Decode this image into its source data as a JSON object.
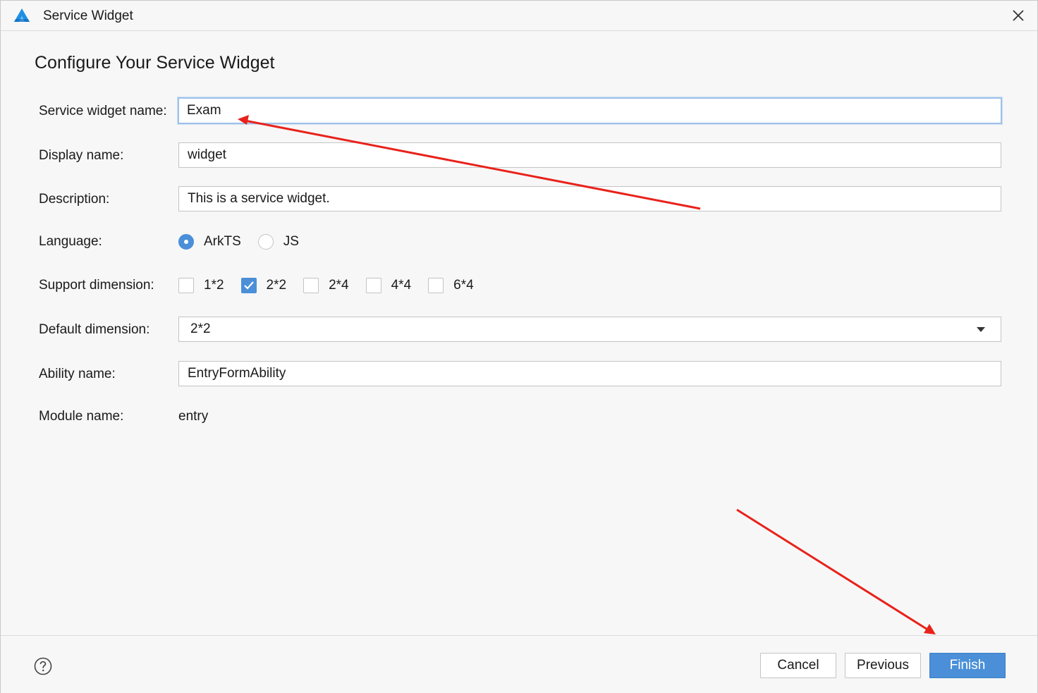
{
  "window": {
    "title": "Service Widget"
  },
  "heading": "Configure Your Service Widget",
  "form": {
    "service_widget_name": {
      "label": "Service widget name:",
      "value": "Exam"
    },
    "display_name": {
      "label": "Display name:",
      "value": "widget"
    },
    "description": {
      "label": "Description:",
      "value": "This is a service widget."
    },
    "language": {
      "label": "Language:",
      "options": [
        {
          "label": "ArkTS",
          "selected": true
        },
        {
          "label": "JS",
          "selected": false
        }
      ]
    },
    "support_dimension": {
      "label": "Support dimension:",
      "options": [
        {
          "label": "1*2",
          "checked": false
        },
        {
          "label": "2*2",
          "checked": true
        },
        {
          "label": "2*4",
          "checked": false
        },
        {
          "label": "4*4",
          "checked": false
        },
        {
          "label": "6*4",
          "checked": false
        }
      ]
    },
    "default_dimension": {
      "label": "Default dimension:",
      "value": "2*2"
    },
    "ability_name": {
      "label": "Ability name:",
      "value": "EntryFormAbility"
    },
    "module_name": {
      "label": "Module name:",
      "value": "entry"
    }
  },
  "footer": {
    "cancel_label": "Cancel",
    "previous_label": "Previous",
    "finish_label": "Finish"
  },
  "colors": {
    "accent": "#4a8fd8",
    "annotation_arrow": "#e8221b",
    "background": "#f7f7f7"
  },
  "icons": {
    "app": "app-logo-icon",
    "close": "close-icon",
    "help": "help-icon"
  }
}
